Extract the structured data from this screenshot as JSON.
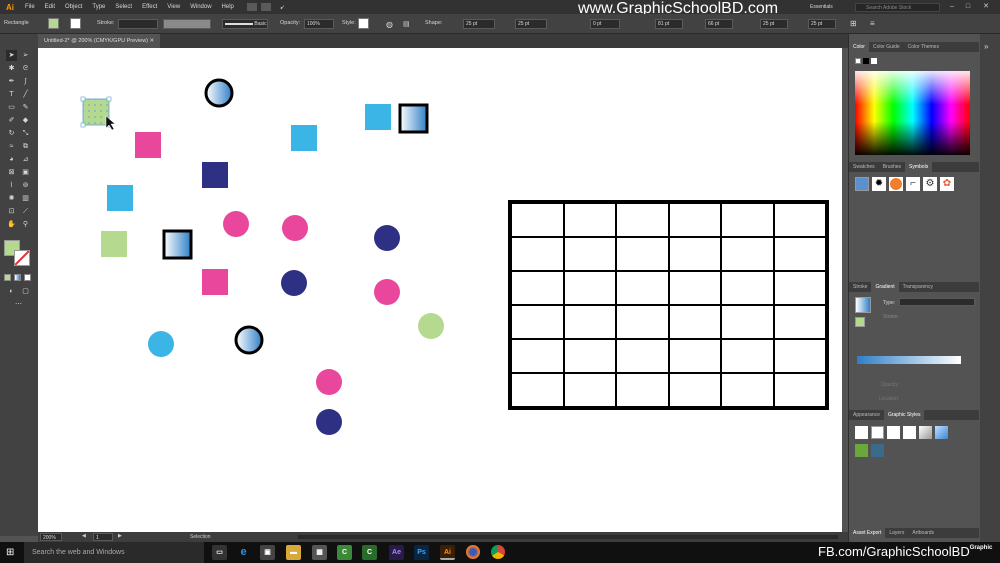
{
  "app": {
    "logo": "Ai",
    "menu": [
      "File",
      "Edit",
      "Object",
      "Type",
      "Select",
      "Effect",
      "View",
      "Window",
      "Help"
    ],
    "workspace": "Essentials",
    "search_placeholder": "Search Adobe Stock",
    "watermark_top": "www.GraphicSchoolBD.com",
    "watermark_bottom": "FB.com/GraphicSchoolBD"
  },
  "control_bar": {
    "selection_label": "Rectangle",
    "stroke_label": "Stroke:",
    "brush": "Basic",
    "opacity_label": "Opacity:",
    "opacity_value": "100%",
    "style_label": "Style:",
    "shape_label": "Shape:",
    "w_value": "25 pt",
    "h_value": "25 pt",
    "corner_value": "0 pt",
    "x_value": "81 pt",
    "y_value": "66 pt",
    "w2_value": "25 pt",
    "h2_value": "25 pt"
  },
  "document": {
    "tab_title": "Untitled-2* @ 200% (CMYK/GPU Preview)",
    "zoom": "200%",
    "artboard": "1",
    "status": "Selection"
  },
  "panels": {
    "color_tabs": [
      "Color",
      "Color Guide",
      "Color Themes"
    ],
    "swatch_tabs": [
      "Swatches",
      "Brushes",
      "Symbols"
    ],
    "gradient_tabs": [
      "Stroke",
      "Gradient",
      "Transparency"
    ],
    "gradient_type_label": "Type:",
    "gradient_stroke_label": "Stroke:",
    "opacity_label": "Opacity:",
    "location_label": "Location:",
    "appearance_tabs": [
      "Appearance",
      "Graphic Styles"
    ],
    "export_tabs": [
      "Asset Export",
      "Layers",
      "Artboards"
    ]
  },
  "taskbar": {
    "search_placeholder": "Search the web and Windows",
    "apps": [
      "task-view",
      "edge",
      "store",
      "explorer",
      "calculator",
      "camtasia",
      "camtasia-recorder",
      "after-effects",
      "photoshop",
      "illustrator",
      "firefox",
      "chrome"
    ]
  },
  "colors": {
    "pink": "#e8479b",
    "cyan": "#3bb4e6",
    "navy": "#2e3183",
    "lightgreen": "#b5d98f",
    "gradient_start": "#ffffff",
    "gradient_end": "#2f7fc7"
  }
}
